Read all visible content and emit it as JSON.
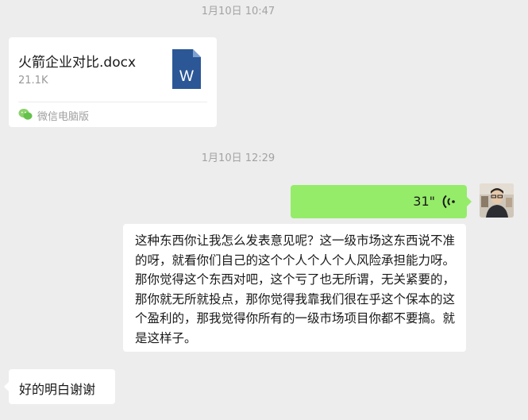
{
  "messages": {
    "timestamp_1": "1月10日 10:47",
    "file": {
      "name": "火箭企业对比.docx",
      "size": "21.1K",
      "icon": "word-document-icon",
      "source": "微信电脑版"
    },
    "timestamp_2": "1月10日 12:29",
    "voice": {
      "duration": "31\"",
      "icon": "voice-wave-icon"
    },
    "transcript": "这种东西你让我怎么发表意见呢？这一级市场这东西说不准的呀，就看你们自己的这个个人个人个人风险承担能力呀。那你觉得这个东西对吧，这个亏了也无所谓，无关紧要的，那你就无所就投点，那你觉得我靠我们很在乎这个保本的这个盈利的，那我觉得你所有的一级市场项目你都不要搞。就是这样子。",
    "reply": "好的明白谢谢"
  },
  "colors": {
    "background": "#ededed",
    "outgoing_bubble": "#95ec69",
    "incoming_bubble": "#ffffff",
    "word_blue": "#2b5797"
  }
}
